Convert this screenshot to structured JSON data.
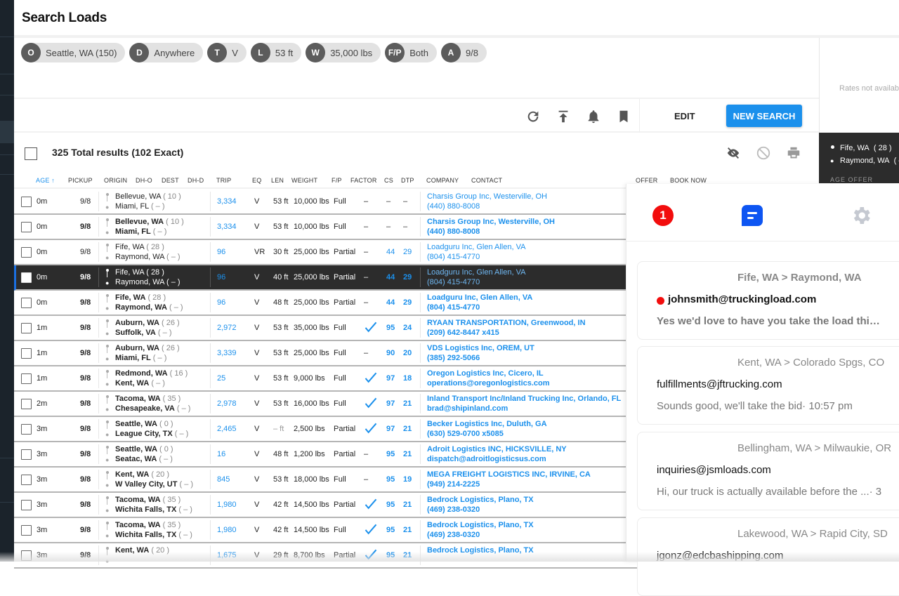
{
  "page": {
    "title": "Search Loads"
  },
  "filters": [
    {
      "key": "O",
      "value": "Seattle, WA (150)",
      "name": "origin"
    },
    {
      "key": "D",
      "value": "Anywhere",
      "name": "destination"
    },
    {
      "key": "T",
      "value": "V",
      "name": "truck-type"
    },
    {
      "key": "L",
      "value": "53 ft",
      "name": "length"
    },
    {
      "key": "W",
      "value": "35,000 lbs",
      "name": "weight"
    },
    {
      "key": "F/P",
      "value": "Both",
      "name": "full-partial"
    },
    {
      "key": "A",
      "value": "9/8",
      "name": "available-date"
    }
  ],
  "rates": {
    "text": "Rates not available"
  },
  "toolbar": {
    "icons": [
      "refresh-icon",
      "upload-icon",
      "bell-icon",
      "bookmark-icon"
    ],
    "edit_label": "EDIT",
    "new_search_label": "NEW SEARCH"
  },
  "results": {
    "count_text": "325 Total results (102 Exact)",
    "icons": [
      "hide-icon",
      "block-icon",
      "print-icon"
    ]
  },
  "preview": {
    "origin": "Fife, WA",
    "origin_dh": "( 28 )",
    "dest": "Raymond, WA",
    "dest_dh": "( –",
    "stub": "AGE      OFFER"
  },
  "table": {
    "headers": {
      "age": "AGE ↑",
      "pickup": "PICKUP",
      "origin": "ORIGIN",
      "dho": "DH-O",
      "dest": "DEST",
      "dhd": "DH-D",
      "trip": "TRIP",
      "eq": "EQ",
      "len": "LEN",
      "weight": "WEIGHT",
      "fp": "F/P",
      "factor": "FACTOR",
      "cs": "CS",
      "dtp": "DTP",
      "company": "COMPANY",
      "contact": "CONTACT",
      "offer": "OFFER",
      "book": "BOOK NOW"
    },
    "rows": [
      {
        "age": "0m",
        "pickup": "9/8",
        "origin": "Bellevue, WA",
        "dho": "( 10 )",
        "dest": "Miami, FL",
        "dhd": "( – )",
        "trip": "3,334",
        "eq": "V",
        "len": "53 ft",
        "weight": "10,000 lbs",
        "fp": "Full",
        "factor": "–",
        "cs": "–",
        "dtp": "–",
        "company": "Charsis Group Inc, Westerville, OH",
        "contact": "(440) 880-8008",
        "offer": "$",
        "style": "light"
      },
      {
        "age": "0m",
        "pickup": "9/8",
        "origin": "Bellevue, WA",
        "dho": "( 10 )",
        "dest": "Miami, FL",
        "dhd": "( – )",
        "trip": "3,334",
        "eq": "V",
        "len": "53 ft",
        "weight": "10,000 lbs",
        "fp": "Full",
        "factor": "–",
        "cs": "–",
        "dtp": "–",
        "company": "Charsis Group Inc, Westerville, OH",
        "contact": "(440) 880-8008",
        "offer": "$",
        "style": "bold"
      },
      {
        "age": "0m",
        "pickup": "9/8",
        "origin": "Fife, WA",
        "dho": "( 28 )",
        "dest": "Raymond, WA",
        "dhd": "( – )",
        "trip": "96",
        "eq": "VR",
        "len": "30 ft",
        "weight": "25,000 lbs",
        "fp": "Partial",
        "factor": "–",
        "cs": "44",
        "dtp": "29",
        "company": "Loadguru Inc, Glen Allen, VA",
        "contact": "(804) 415-4770",
        "offer": "",
        "style": "light"
      },
      {
        "age": "0m",
        "pickup": "9/8",
        "origin": "Fife, WA",
        "dho": "( 28 )",
        "dest": "Raymond, WA",
        "dhd": "( – )",
        "trip": "96",
        "eq": "V",
        "len": "40 ft",
        "weight": "25,000 lbs",
        "fp": "Partial",
        "factor": "–",
        "cs": "44",
        "dtp": "29",
        "company": "Loadguru Inc, Glen Allen, VA",
        "contact": "(804) 415-4770",
        "offer": "",
        "style": "selected"
      },
      {
        "age": "0m",
        "pickup": "9/8",
        "origin": "Fife, WA",
        "dho": "( 28 )",
        "dest": "Raymond, WA",
        "dhd": "( – )",
        "trip": "96",
        "eq": "V",
        "len": "48 ft",
        "weight": "25,000 lbs",
        "fp": "Partial",
        "factor": "–",
        "cs": "44",
        "dtp": "29",
        "company": "Loadguru Inc, Glen Allen, VA",
        "contact": "(804) 415-4770",
        "offer": "",
        "style": "bold"
      },
      {
        "age": "1m",
        "pickup": "9/8",
        "origin": "Auburn, WA",
        "dho": "( 26 )",
        "dest": "Suffolk, VA",
        "dhd": "( – )",
        "trip": "2,972",
        "eq": "V",
        "len": "53 ft",
        "weight": "35,000 lbs",
        "fp": "Full",
        "factor": "check",
        "cs": "95",
        "dtp": "24",
        "company": "RYAAN TRANSPORTATION, Greenwood, IN",
        "contact": "(209) 642-8447 x415",
        "offer": "$",
        "style": "bold"
      },
      {
        "age": "1m",
        "pickup": "9/8",
        "origin": "Auburn, WA",
        "dho": "( 26 )",
        "dest": "Miami, FL",
        "dhd": "( – )",
        "trip": "3,339",
        "eq": "V",
        "len": "53 ft",
        "weight": "25,000 lbs",
        "fp": "Full",
        "factor": "–",
        "cs": "90",
        "dtp": "20",
        "company": "VDS Logistics Inc, OREM, UT",
        "contact": "(385) 292-5066",
        "offer": "$",
        "style": "bold"
      },
      {
        "age": "1m",
        "pickup": "9/8",
        "origin": "Redmond, WA",
        "dho": "( 16 )",
        "dest": "Kent, WA",
        "dhd": "( – )",
        "trip": "25",
        "eq": "V",
        "len": "53 ft",
        "weight": "9,000 lbs",
        "fp": "Full",
        "factor": "check",
        "cs": "97",
        "dtp": "18",
        "company": "Oregon Logistics Inc, Cicero, IL",
        "contact": "operations@oregonlogistics.com",
        "offer": "",
        "style": "bold"
      },
      {
        "age": "2m",
        "pickup": "9/8",
        "origin": "Tacoma, WA",
        "dho": "( 35 )",
        "dest": "Chesapeake, VA",
        "dhd": "( – )",
        "trip": "2,978",
        "eq": "V",
        "len": "53 ft",
        "weight": "16,000 lbs",
        "fp": "Full",
        "factor": "check",
        "cs": "97",
        "dtp": "21",
        "company": "Inland Transport Inc/Inland Trucking Inc, Orlando, FL",
        "contact": "brad@shipinland.com",
        "offer": "$",
        "style": "bold"
      },
      {
        "age": "3m",
        "pickup": "9/8",
        "origin": "Seattle, WA",
        "dho": "( 0 )",
        "dest": "League City, TX",
        "dhd": "( – )",
        "trip": "2,465",
        "eq": "V",
        "len": "– ft",
        "weight": "2,500 lbs",
        "fp": "Partial",
        "factor": "check",
        "cs": "97",
        "dtp": "21",
        "company": "Becker Logistics Inc, Duluth, GA",
        "contact": "(630) 529-0700 x5085",
        "offer": "",
        "style": "bold"
      },
      {
        "age": "3m",
        "pickup": "9/8",
        "origin": "Seattle, WA",
        "dho": "( 0 )",
        "dest": "Seatac, WA",
        "dhd": "( – )",
        "trip": "16",
        "eq": "V",
        "len": "48 ft",
        "weight": "1,200 lbs",
        "fp": "Partial",
        "factor": "–",
        "cs": "95",
        "dtp": "21",
        "company": "Adroit Logistics INC, HICKSVILLE, NY",
        "contact": "dispatch@adroitlogisticsus.com",
        "offer": "",
        "style": "bold"
      },
      {
        "age": "3m",
        "pickup": "9/8",
        "origin": "Kent, WA",
        "dho": "( 20 )",
        "dest": "W Valley City, UT",
        "dhd": "( – )",
        "trip": "845",
        "eq": "V",
        "len": "53 ft",
        "weight": "18,000 lbs",
        "fp": "Full",
        "factor": "–",
        "cs": "95",
        "dtp": "19",
        "company": "MEGA FREIGHT LOGISTICS INC, IRVINE, CA",
        "contact": "(949) 214-2225",
        "offer": "$",
        "style": "bold"
      },
      {
        "age": "3m",
        "pickup": "9/8",
        "origin": "Tacoma, WA",
        "dho": "( 35 )",
        "dest": "Wichita Falls, TX",
        "dhd": "( – )",
        "trip": "1,980",
        "eq": "V",
        "len": "42 ft",
        "weight": "14,500 lbs",
        "fp": "Partial",
        "factor": "check",
        "cs": "95",
        "dtp": "21",
        "company": "Bedrock Logistics, Plano, TX",
        "contact": "(469) 238-0320",
        "offer": "$",
        "style": "bold"
      },
      {
        "age": "3m",
        "pickup": "9/8",
        "origin": "Tacoma, WA",
        "dho": "( 35 )",
        "dest": "Wichita Falls, TX",
        "dhd": "( – )",
        "trip": "1,980",
        "eq": "V",
        "len": "42 ft",
        "weight": "14,500 lbs",
        "fp": "Full",
        "factor": "check",
        "cs": "95",
        "dtp": "21",
        "company": "Bedrock Logistics, Plano, TX",
        "contact": "(469) 238-0320",
        "offer": "$",
        "style": "bold"
      },
      {
        "age": "3m",
        "pickup": "9/8",
        "origin": "Kent, WA",
        "dho": "( 20 )",
        "dest": "",
        "dhd": "",
        "trip": "1,675",
        "eq": "V",
        "len": "29 ft",
        "weight": "8,700 lbs",
        "fp": "Partial",
        "factor": "check",
        "cs": "95",
        "dtp": "21",
        "company": "Bedrock Logistics, Plano, TX",
        "contact": "",
        "offer": "$",
        "style": "bold"
      }
    ]
  },
  "messages": {
    "notification_count": "1",
    "cards": [
      {
        "route": "Fife, WA > Raymond, WA",
        "email": "johnsmith@truckingload.com",
        "snippet": "Yes we'd love to have you take the load thi…",
        "unread": true
      },
      {
        "route": "Kent, WA > Colorado Spgs, CO",
        "email": "fulfillments@jftrucking.com",
        "snippet": "Sounds good, we'll take the bid· 10:57 pm",
        "unread": false
      },
      {
        "route": "Bellingham, WA > Milwaukie, OR",
        "email": "inquiries@jsmloads.com",
        "snippet": "Hi, our truck is actually available before the ...· 3",
        "unread": false
      },
      {
        "route": "Lakewood, WA > Rapid City, SD",
        "email": "jgonz@edcbashipping.com",
        "snippet": "",
        "unread": false
      }
    ]
  },
  "colors": {
    "accent": "#1b90ec",
    "selected_row": "#2c2c2c",
    "unread_dot": "#f20d0d",
    "message_icon": "#0d55f2",
    "sidebar": "#1b232b"
  }
}
